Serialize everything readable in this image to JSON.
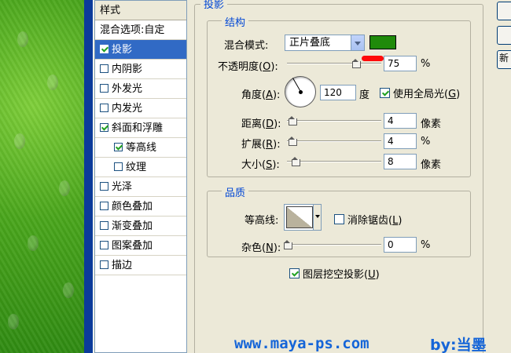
{
  "styles_panel": {
    "header": "样式",
    "blend_options": "混合选项:自定",
    "items": [
      {
        "label": "投影",
        "checked": true,
        "selected": true,
        "sub": false
      },
      {
        "label": "内阴影",
        "checked": false,
        "selected": false,
        "sub": false
      },
      {
        "label": "外发光",
        "checked": false,
        "selected": false,
        "sub": false
      },
      {
        "label": "内发光",
        "checked": false,
        "selected": false,
        "sub": false
      },
      {
        "label": "斜面和浮雕",
        "checked": true,
        "selected": false,
        "sub": false
      },
      {
        "label": "等高线",
        "checked": true,
        "selected": false,
        "sub": true
      },
      {
        "label": "纹理",
        "checked": false,
        "selected": false,
        "sub": true
      },
      {
        "label": "光泽",
        "checked": false,
        "selected": false,
        "sub": false
      },
      {
        "label": "颜色叠加",
        "checked": false,
        "selected": false,
        "sub": false
      },
      {
        "label": "渐变叠加",
        "checked": false,
        "selected": false,
        "sub": false
      },
      {
        "label": "图案叠加",
        "checked": false,
        "selected": false,
        "sub": false
      },
      {
        "label": "描边",
        "checked": false,
        "selected": false,
        "sub": false
      }
    ]
  },
  "drop_shadow": {
    "section_title": "投影",
    "structure": {
      "title": "结构",
      "blend_mode_label": "混合模式:",
      "blend_mode_value": "正片叠底",
      "shadow_color": "#1f8a0a",
      "opacity_label": "不透明度(",
      "opacity_key": "O",
      "opacity_value": "75",
      "opacity_unit": "%",
      "opacity_percent": 75,
      "angle_label": "角度(",
      "angle_key": "A",
      "angle_value": "120",
      "angle_unit": "度",
      "angle_degrees": 120,
      "global_light_label": "使用全局光(",
      "global_light_key": "G",
      "global_light_checked": true,
      "distance_label": "距离(",
      "distance_key": "D",
      "distance_value": "4",
      "distance_unit": "像素",
      "spread_label": "扩展(",
      "spread_key": "R",
      "spread_value": "4",
      "spread_unit": "%",
      "size_label": "大小(",
      "size_key": "S",
      "size_value": "8",
      "size_unit": "像素"
    },
    "quality": {
      "title": "品质",
      "contour_label": "等高线:",
      "anti_alias_label": "消除锯齿(",
      "anti_alias_key": "L",
      "anti_alias_checked": false,
      "noise_label": "杂色(",
      "noise_key": "N",
      "noise_value": "0",
      "noise_unit": "%"
    },
    "knockout_label": "图层挖空投影(",
    "knockout_key": "U",
    "knockout_checked": true
  },
  "watermark": {
    "site": "www.maya-ps.com",
    "byline": "by:当墨"
  },
  "right_buttons": [
    "",
    "",
    "新"
  ]
}
